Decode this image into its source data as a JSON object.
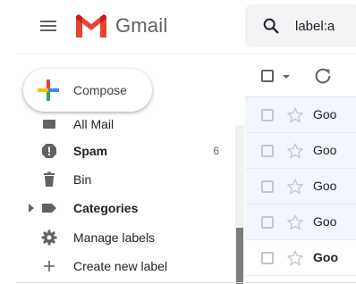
{
  "header": {
    "logo_text": "Gmail",
    "search_text": "label:a"
  },
  "compose": {
    "label": "Compose"
  },
  "sidebar": {
    "items": [
      {
        "label": "All Mail",
        "count": "",
        "bold": false,
        "icon": "all-mail-icon"
      },
      {
        "label": "Spam",
        "count": "6",
        "bold": true,
        "icon": "spam-icon"
      },
      {
        "label": "Bin",
        "count": "",
        "bold": false,
        "icon": "bin-icon"
      },
      {
        "label": "Categories",
        "count": "",
        "bold": true,
        "icon": "label-icon"
      },
      {
        "label": "Manage labels",
        "count": "",
        "bold": false,
        "icon": "gear-icon"
      },
      {
        "label": "Create new label",
        "count": "",
        "bold": false,
        "icon": "plus-icon"
      }
    ]
  },
  "email_list": {
    "rows": [
      {
        "sender": "Goo",
        "unread": false
      },
      {
        "sender": "Goo",
        "unread": false
      },
      {
        "sender": "Goo",
        "unread": false
      },
      {
        "sender": "Goo",
        "unread": false
      },
      {
        "sender": "Goo",
        "unread": true
      }
    ]
  },
  "colors": {
    "gmail_red": "#ea4335",
    "read_row_bg": "#f2f6fc",
    "icon_grey": "#5f6368"
  }
}
